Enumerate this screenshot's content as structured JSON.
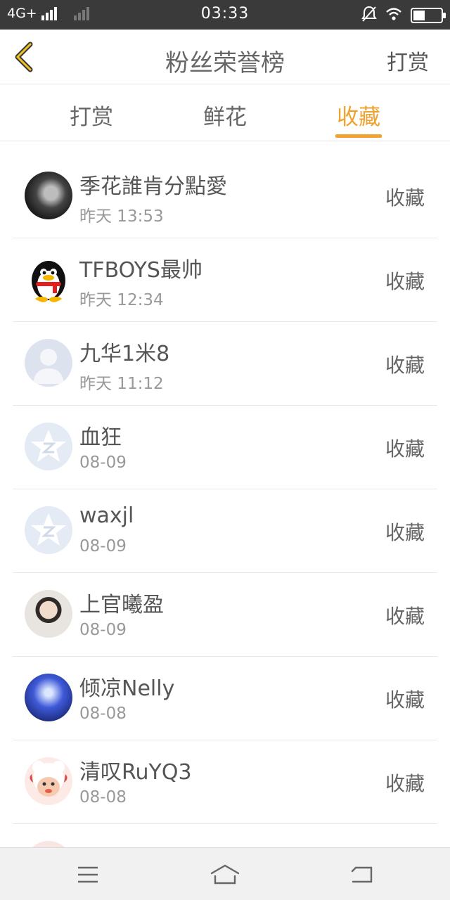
{
  "status": {
    "network": "4G+",
    "time": "03:33"
  },
  "nav": {
    "title": "粉丝荣誉榜",
    "right_action": "打赏"
  },
  "tabs": [
    {
      "label": "打赏",
      "active": false
    },
    {
      "label": "鲜花",
      "active": false
    },
    {
      "label": "收藏",
      "active": true
    }
  ],
  "colors": {
    "accent": "#f0a22e",
    "statusbar": "#3a3a3a"
  },
  "rows": [
    {
      "name": "季花誰肯分點愛",
      "time": "昨天 13:53",
      "action": "收藏",
      "avatar": "photo-dark"
    },
    {
      "name": "TFBOYS最帅",
      "time": "昨天 12:34",
      "action": "收藏",
      "avatar": "qq-penguin"
    },
    {
      "name": "九华1米8",
      "time": "昨天 11:12",
      "action": "收藏",
      "avatar": "default-person"
    },
    {
      "name": "血狂",
      "time": "08-09",
      "action": "收藏",
      "avatar": "qzone-star"
    },
    {
      "name": "waxjl",
      "time": "08-09",
      "action": "收藏",
      "avatar": "qzone-star"
    },
    {
      "name": "上官曦盈",
      "time": "08-09",
      "action": "收藏",
      "avatar": "photo-boy"
    },
    {
      "name": "倾凉Nelly",
      "time": "08-08",
      "action": "收藏",
      "avatar": "photo-stage"
    },
    {
      "name": "清叹RuYQ3",
      "time": "08-08",
      "action": "收藏",
      "avatar": "cartoon-sheep"
    }
  ]
}
